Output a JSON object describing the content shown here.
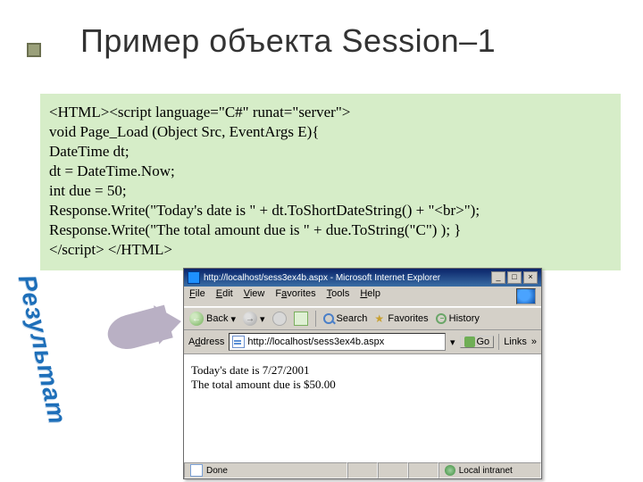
{
  "slide": {
    "title": "Пример объекта Session–1"
  },
  "code": {
    "l1": "<HTML><script language=\"C#\" runat=\"server\">",
    "l2": "void Page_Load (Object Src, EventArgs E){",
    "l3": "DateTime dt;",
    "l4": "dt = DateTime.Now;",
    "l5": "int due = 50;",
    "l6": "Response.Write(\"Today's date is \" + dt.ToShortDateString() + \"<br>\");",
    "l7": "Response.Write(\"The total amount due is \" + due.ToString(\"C\") ); }",
    "l8": "</script> </HTML>"
  },
  "result_label": "Результат",
  "browser": {
    "title": "http://localhost/sess3ex4b.aspx - Microsoft Internet Explorer",
    "menu": {
      "file": "File",
      "edit": "Edit",
      "view": "View",
      "favorites": "Favorites",
      "tools": "Tools",
      "help": "Help"
    },
    "toolbar": {
      "back": "Back",
      "search": "Search",
      "favorites": "Favorites",
      "history": "History"
    },
    "address_label": "Address",
    "address_value": "http://localhost/sess3ex4b.aspx",
    "go": "Go",
    "links": "Links",
    "content": {
      "line1": "Today's date is 7/27/2001",
      "line2": "The total amount due is $50.00"
    },
    "status_done": "Done",
    "status_zone": "Local intranet"
  },
  "winbtns": {
    "min": "_",
    "max": "□",
    "close": "×"
  }
}
